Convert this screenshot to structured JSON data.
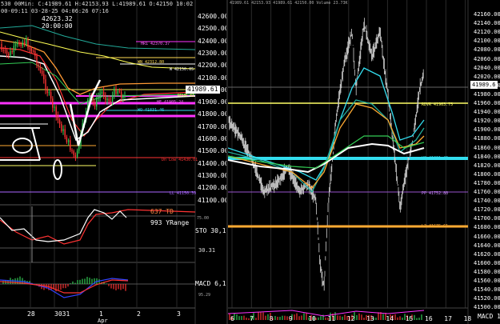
{
  "left_chart": {
    "header": "530 00Min: C:41989.61 H:42153.93 L:41989.61 O:42150 10:02",
    "dates": "00-09:11 03-28-25 04:06:26 07:16",
    "pivot_label": "42623.32",
    "pivot_sub": "20:00:00",
    "price_axis": [
      "42600.00",
      "42500.00",
      "42400.00",
      "42300.00",
      "42200.00",
      "42100.00",
      "42000.00",
      "41900.00",
      "41800.00",
      "41700.00",
      "41600.00",
      "41500.00",
      "41400.00",
      "41300.00",
      "41200.00",
      "41100.00"
    ],
    "current_price": "41989.61",
    "level_labels": {
      "hr1": "HR1 42370.37",
      "wn": "WN 42312.80",
      "w": "W 42150.05",
      "rdvr": "RDVR 41",
      "hf": "HF 41905.24",
      "wo": "WO 41831.46",
      "dlow": "Dn Low 41430.01",
      "ll": "LL 41150.39"
    },
    "x_labels": [
      "28",
      "3031",
      "1",
      "2",
      "3"
    ],
    "x_sub": "Apr",
    "stoch_legend": [
      "637 TD",
      "993 YRange"
    ],
    "stoch_label": "STO 30,1",
    "stoch_axis": [
      "75.00",
      "30.31"
    ],
    "macd_label": "MACD 6,1",
    "macd_axis": [
      "95.29"
    ]
  },
  "right_chart": {
    "header": "41989.61 42153.93 41989.61 42150.00 Volume 23.73K",
    "price_axis": [
      "42160.00",
      "42140.00",
      "42120.00",
      "42100.00",
      "42080.00",
      "42060.00",
      "42040.00",
      "42020.00",
      "42000.00",
      "41980.00",
      "41960.00",
      "41940.00",
      "41920.00",
      "41900.00",
      "41880.00",
      "41860.00",
      "41840.00",
      "41820.00",
      "41800.00",
      "41780.00",
      "41760.00",
      "41740.00",
      "41720.00",
      "41700.00",
      "41680.00",
      "41660.00",
      "41640.00",
      "41620.00",
      "41600.00",
      "41580.00",
      "41560.00",
      "41540.00",
      "41520.00",
      "41500.00"
    ],
    "current_price": "41989.6",
    "level_labels": {
      "rdvr": "RDVR 41963.75",
      "wo": "WO 41831.46",
      "pp": "PP 41752.80",
      "l3": "L3 41675.61"
    },
    "x_labels": [
      "6",
      "7",
      "8",
      "9",
      "10",
      "11",
      "12",
      "13",
      "14",
      "15",
      "16",
      "17",
      "18"
    ],
    "footer_label": "MACD 1"
  },
  "colors": {
    "bg": "#000000",
    "white": "#ffffff",
    "yellow": "#ffff66",
    "orange": "#ffaa33",
    "cyan": "#33ddee",
    "magenta": "#ff33ff",
    "purple": "#aa66ff",
    "red": "#ff3333",
    "green": "#33cc55",
    "teal": "#22aa99",
    "grid": "#2a2a2a"
  }
}
